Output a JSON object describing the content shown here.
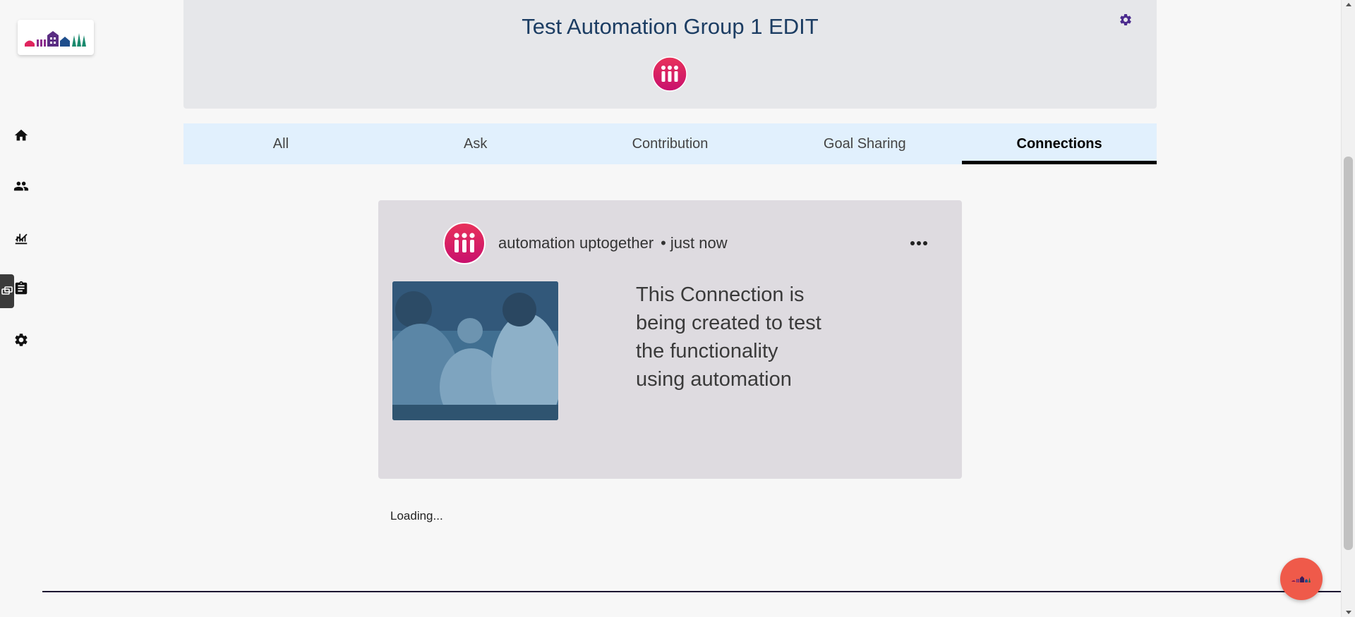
{
  "header": {
    "group_title": "Test Automation Group 1 EDIT"
  },
  "tabs": [
    {
      "label": "All",
      "active": false
    },
    {
      "label": "Ask",
      "active": false
    },
    {
      "label": "Contribution",
      "active": false
    },
    {
      "label": "Goal Sharing",
      "active": false
    },
    {
      "label": "Connections",
      "active": true
    }
  ],
  "sidebar": {
    "items": [
      {
        "icon": "home-icon"
      },
      {
        "icon": "people-icon"
      },
      {
        "icon": "chart-icon"
      },
      {
        "icon": "clipboard-icon"
      },
      {
        "icon": "gear-icon"
      }
    ]
  },
  "post": {
    "author": "automation uptogether",
    "separator": "•",
    "time": "just now",
    "text": "This Connection is being created to test the functionality using automation"
  },
  "status": {
    "loading": "Loading..."
  },
  "colors": {
    "brand_pink": "#e0245e",
    "brand_purple": "#4b2b8e",
    "header_title": "#1c3d63",
    "fab": "#ef5a4a"
  }
}
